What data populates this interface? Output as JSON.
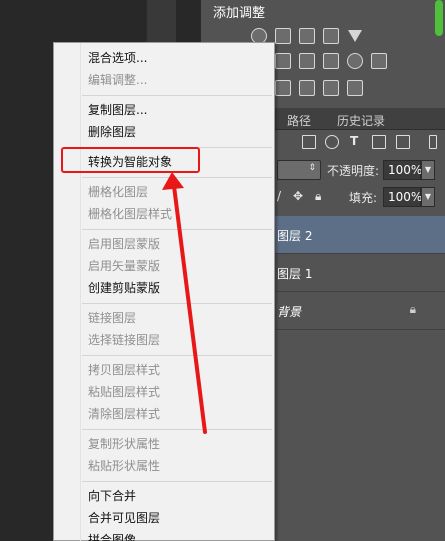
{
  "adjustments": {
    "title": "添加调整"
  },
  "layers_panel": {
    "tabs": [
      "路径",
      "历史记录"
    ],
    "opacity_label": "不透明度:",
    "opacity_value": "100%",
    "fill_label": "填充:",
    "fill_value": "100%",
    "layers": [
      {
        "name": "图层 2",
        "selected": true
      },
      {
        "name": "图层 1",
        "selected": false
      },
      {
        "name": "背景",
        "selected": false,
        "locked": true
      }
    ]
  },
  "context_menu": {
    "groups": [
      [
        {
          "label": "混合选项...",
          "enabled": true
        },
        {
          "label": "编辑调整...",
          "enabled": false
        }
      ],
      [
        {
          "label": "复制图层...",
          "enabled": true
        },
        {
          "label": "删除图层",
          "enabled": true
        }
      ],
      [
        {
          "label": "转换为智能对象",
          "enabled": true,
          "highlighted": true
        }
      ],
      [
        {
          "label": "栅格化图层",
          "enabled": false
        },
        {
          "label": "栅格化图层样式",
          "enabled": false
        }
      ],
      [
        {
          "label": "启用图层蒙版",
          "enabled": false
        },
        {
          "label": "启用矢量蒙版",
          "enabled": false
        },
        {
          "label": "创建剪贴蒙版",
          "enabled": true
        }
      ],
      [
        {
          "label": "链接图层",
          "enabled": false
        },
        {
          "label": "选择链接图层",
          "enabled": false
        }
      ],
      [
        {
          "label": "拷贝图层样式",
          "enabled": false
        },
        {
          "label": "粘贴图层样式",
          "enabled": false
        },
        {
          "label": "清除图层样式",
          "enabled": false
        }
      ],
      [
        {
          "label": "复制形状属性",
          "enabled": false
        },
        {
          "label": "粘贴形状属性",
          "enabled": false
        }
      ],
      [
        {
          "label": "向下合并",
          "enabled": true
        },
        {
          "label": "合并可见图层",
          "enabled": true
        },
        {
          "label": "拼合图像",
          "enabled": true
        }
      ]
    ]
  },
  "colors": {
    "highlight": "#e81818",
    "selected_layer": "#5d6f86",
    "menu_bg": "#f1f1f1"
  }
}
